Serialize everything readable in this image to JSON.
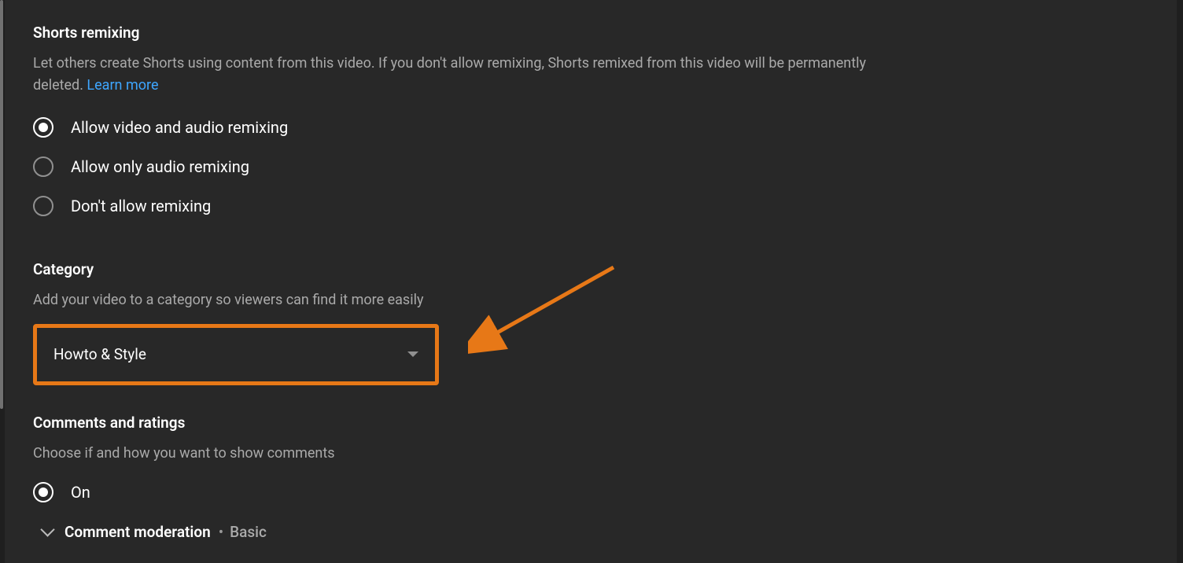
{
  "shorts": {
    "title": "Shorts remixing",
    "desc_part1": "Let others create Shorts using content from this video. If you don't allow remixing, Shorts remixed from this video will be permanently deleted. ",
    "learn_more": "Learn more",
    "options": [
      {
        "label": "Allow video and audio remixing",
        "selected": true
      },
      {
        "label": "Allow only audio remixing",
        "selected": false
      },
      {
        "label": "Don't allow remixing",
        "selected": false
      }
    ]
  },
  "category": {
    "title": "Category",
    "desc": "Add your video to a category so viewers can find it more easily",
    "selected": "Howto & Style"
  },
  "comments": {
    "title": "Comments and ratings",
    "desc": "Choose if and how you want to show comments",
    "options": [
      {
        "label": "On",
        "selected": true
      }
    ],
    "moderation_label": "Comment moderation",
    "moderation_value": "Basic"
  }
}
